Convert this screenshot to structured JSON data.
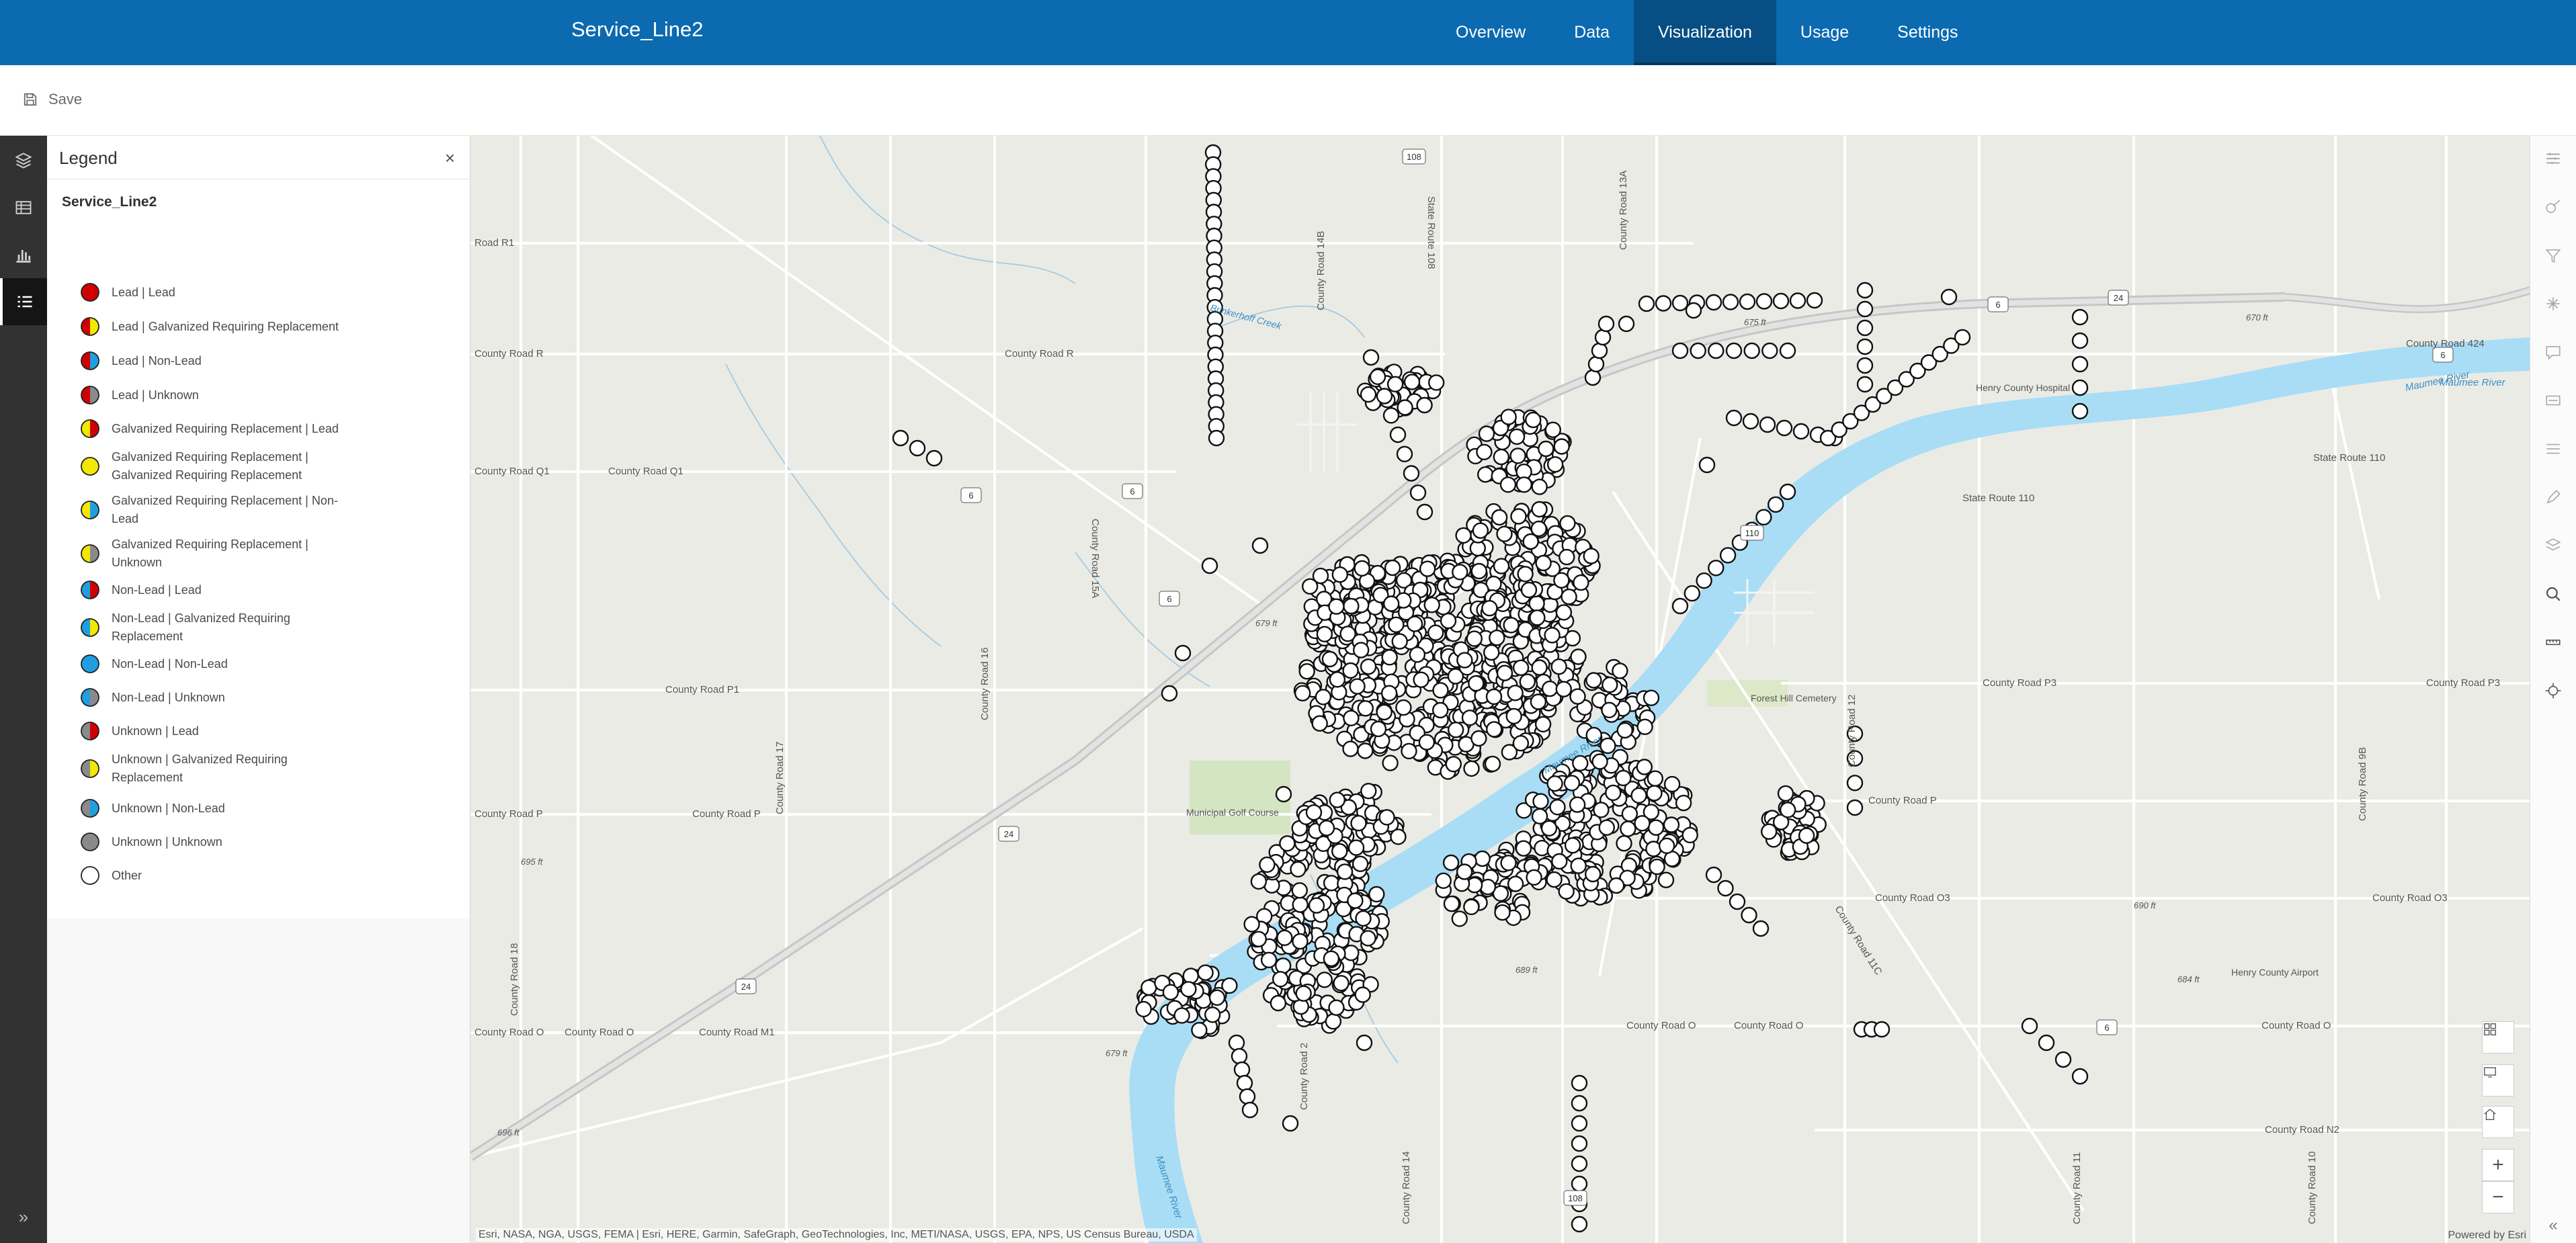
{
  "header": {
    "app_title": "Service_Line2",
    "tabs": [
      {
        "label": "Overview",
        "active": false
      },
      {
        "label": "Data",
        "active": false
      },
      {
        "label": "Visualization",
        "active": true
      },
      {
        "label": "Usage",
        "active": false
      },
      {
        "label": "Settings",
        "active": false
      }
    ]
  },
  "toolbar": {
    "save_label": "Save"
  },
  "rail": {
    "icons": [
      "layers-icon",
      "table-icon",
      "chart-icon",
      "legend-icon"
    ],
    "active": "legend-icon",
    "expand_label": "»"
  },
  "legend": {
    "title": "Legend",
    "close_label": "×",
    "layer_name": "Service_Line2",
    "colors": {
      "lead": "#d00000",
      "galvanized": "#f2e800",
      "non_lead": "#1f9fe0",
      "unknown": "#8a8a8a",
      "other": "#ffffff"
    },
    "items": [
      {
        "label": "Lead | Lead",
        "left": "lead",
        "right": "lead"
      },
      {
        "label": "Lead | Galvanized Requiring Replacement",
        "left": "lead",
        "right": "galvanized"
      },
      {
        "label": "Lead | Non-Lead",
        "left": "lead",
        "right": "non_lead"
      },
      {
        "label": "Lead | Unknown",
        "left": "lead",
        "right": "unknown"
      },
      {
        "label": "Galvanized Requiring Replacement | Lead",
        "left": "galvanized",
        "right": "lead"
      },
      {
        "label": "Galvanized Requiring Replacement | Galvanized Requiring Replacement",
        "left": "galvanized",
        "right": "galvanized"
      },
      {
        "label": "Galvanized Requiring Replacement | Non-Lead",
        "left": "galvanized",
        "right": "non_lead"
      },
      {
        "label": "Galvanized Requiring Replacement | Unknown",
        "left": "galvanized",
        "right": "unknown"
      },
      {
        "label": "Non-Lead | Lead",
        "left": "non_lead",
        "right": "lead"
      },
      {
        "label": "Non-Lead | Galvanized Requiring Replacement",
        "left": "non_lead",
        "right": "galvanized"
      },
      {
        "label": "Non-Lead | Non-Lead",
        "left": "non_lead",
        "right": "non_lead"
      },
      {
        "label": "Non-Lead | Unknown",
        "left": "non_lead",
        "right": "unknown"
      },
      {
        "label": "Unknown | Lead",
        "left": "unknown",
        "right": "lead"
      },
      {
        "label": "Unknown | Galvanized Requiring Replacement",
        "left": "unknown",
        "right": "galvanized"
      },
      {
        "label": "Unknown | Non-Lead",
        "left": "unknown",
        "right": "non_lead"
      },
      {
        "label": "Unknown | Unknown",
        "left": "unknown",
        "right": "unknown"
      },
      {
        "label": "Other",
        "left": "other",
        "right": "other"
      }
    ]
  },
  "map": {
    "colors": {
      "land": "#ebebe6",
      "water": "#a8ddf5",
      "road": "#ffffff",
      "highway": "#c9c9c9",
      "park": "#cfe3bd"
    },
    "labels": {
      "road_r1": "Road R1",
      "county_road_r_w": "County Road R",
      "county_road_r_e": "County Road R",
      "county_road_q1": "County Road Q1",
      "county_road_p1": "County Road P1",
      "county_road_p_w": "County Road P",
      "county_road_p_e": "County Road P",
      "county_road_p3": "County Road P3",
      "county_road_o3": "County Road O3",
      "county_road_o_w": "County Road O",
      "county_road_o_e": "County Road O",
      "county_road_m1": "County Road M1",
      "county_road_n2": "County Road N2",
      "county_road_424": "County Road 424",
      "state_route_110": "State Route 110",
      "state_route_108": "State Route 108",
      "county_road_13a": "County Road 13A",
      "county_road_14b": "County Road 14B",
      "county_road_15a": "County Road 15A",
      "county_road_16": "County Road 16",
      "county_road_17": "County Road 17",
      "county_road_18": "County Road 18",
      "county_road_12": "County Road 12",
      "county_road_11c": "County Road 11C",
      "county_road_9b": "County Road 9B",
      "county_road_2": "County Road 2",
      "county_road_14": "County Road 14",
      "county_road_11": "County Road 11",
      "county_road_10": "County Road 10",
      "maumee_river_e": "Maumee River",
      "maumee_river_e2": "Maumee River",
      "maumee_river_c": "Maumee River",
      "maumee_river_s": "Maumee River",
      "henry_county_hospital": "Henry County Hospital",
      "henry_county_airport": "Henry County Airport",
      "municipal_golf_course": "Municipal Golf Course",
      "cemetery": "Forest Hill Cemetery",
      "creek": "Brinkerhoff Creek",
      "elev_675": "675 ft",
      "elev_670": "670 ft",
      "elev_679": "679 ft",
      "elev_679b": "679 ft",
      "elev_695": "695 ft",
      "elev_696": "696 ft",
      "elev_689": "689 ft",
      "elev_690": "690 ft",
      "elev_684": "684 ft",
      "shield_6": "6",
      "shield_24": "24",
      "shield_108": "108",
      "shield_110": "110"
    },
    "attribution": "Esri, NASA, NGA, USGS, FEMA | Esri, HERE, Garmin, SafeGraph, GeoTechnologies, Inc, METI/NASA, USGS, EPA, NPS, US Census Bureau, USDA",
    "powered_by": "Powered by Esri",
    "controls": [
      "basemap-gallery-icon",
      "screen-icon",
      "home-icon",
      "zoom-in-icon",
      "zoom-out-icon"
    ]
  },
  "right_rail": {
    "icons": [
      "properties-icon",
      "styles-icon",
      "filter-icon",
      "effects-icon",
      "popups-icon",
      "labels-icon",
      "fields-icon",
      "sketch-icon",
      "layer-icon",
      "search-icon",
      "measure-icon",
      "location-icon"
    ],
    "collapse_label": "«"
  }
}
